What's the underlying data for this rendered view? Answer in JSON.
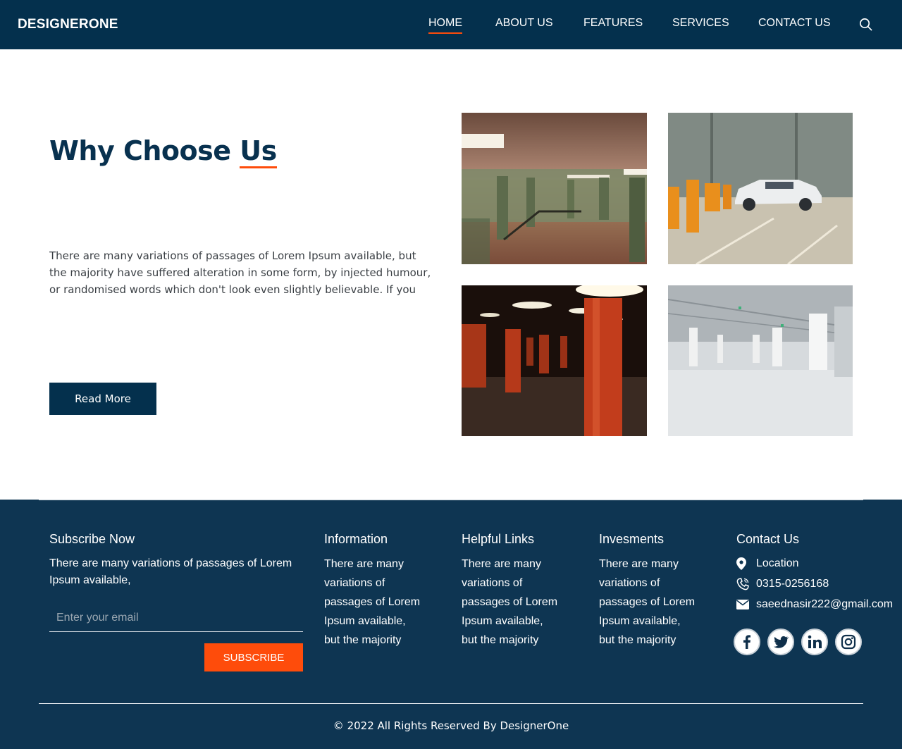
{
  "header": {
    "brand": "DESIGNERONE",
    "nav": [
      "HOME",
      "ABOUT US",
      "FEATURES",
      "SERVICES",
      "CONTACT US"
    ],
    "active": "HOME",
    "search_icon": "search-icon"
  },
  "hero": {
    "title_main": "Why Choose ",
    "title_accent": "Us",
    "text": "There are many variations of passages of Lorem Ipsum available, but the majority have suffered alteration in some form, by injected humour, or randomised words which don't look even slightly believable. If you are",
    "button": "Read More"
  },
  "gallery": {
    "images": [
      "subway-underpass-photo",
      "parking-garage-car-photo",
      "red-pillars-hall-photo",
      "white-parking-garage-photo"
    ]
  },
  "footer": {
    "subscribe": {
      "title": "Subscribe Now",
      "text": "There are many variations of passages of Lorem Ipsum available,",
      "email_placeholder": "Enter your email",
      "button": "SUBSCRIBE"
    },
    "information": {
      "title": "Information",
      "lines": [
        "There are many",
        "variations of",
        "passages of Lorem",
        "Ipsum available,",
        "but the majority"
      ]
    },
    "helpful_links": {
      "title": "Helpful Links",
      "lines": [
        "There are many",
        "variations of",
        "passages of Lorem",
        "Ipsum available,",
        "but the majority"
      ]
    },
    "investments": {
      "title": "Invesments",
      "lines": [
        "There are many",
        "variations of",
        "passages of Lorem",
        "Ipsum available,",
        "but the majority"
      ]
    },
    "contact": {
      "title": "Contact Us",
      "location": "Location",
      "phone": "0315-0256168",
      "email": "saeednasir222@gmail.com"
    },
    "social": [
      "facebook-icon",
      "twitter-icon",
      "linkedin-icon",
      "instagram-icon"
    ],
    "copyright": "© 2022 All Rights Reserved By DesignerOne"
  },
  "colors": {
    "navy": "#04304d",
    "footer_bg": "#0e3552",
    "accent": "#fe4c0b"
  }
}
